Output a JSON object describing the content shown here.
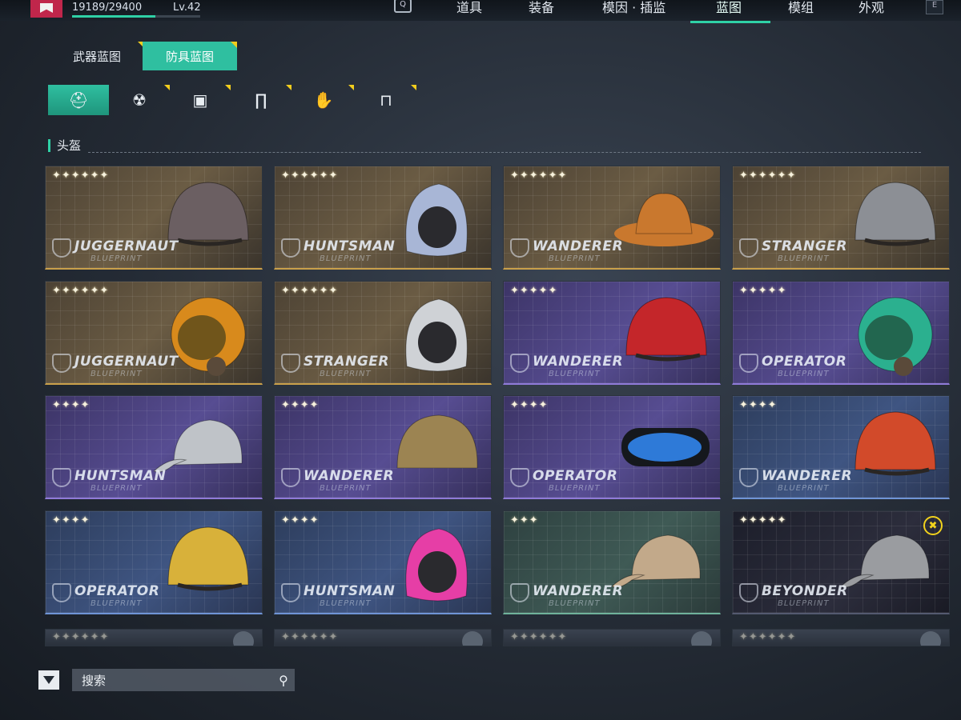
{
  "header": {
    "xp": "19189/29400",
    "xp_progress": 0.653,
    "level": "Lv.42",
    "search_key": "Q",
    "right_key": "E",
    "nav": [
      {
        "label": "道具"
      },
      {
        "label": "装备"
      },
      {
        "label": "模因 · 插监"
      },
      {
        "label": "蓝图"
      },
      {
        "label": "模组"
      },
      {
        "label": "外观"
      }
    ],
    "active_nav": "蓝图"
  },
  "main_tabs": [
    {
      "label": "武器蓝图",
      "active": false
    },
    {
      "label": "防具蓝图",
      "active": true
    }
  ],
  "category_tabs": [
    {
      "icon": "helmet-icon",
      "glyph": "⛑",
      "active": true
    },
    {
      "icon": "gas-mask-icon",
      "glyph": "☢",
      "active": false
    },
    {
      "icon": "armor-vest-icon",
      "glyph": "▣",
      "active": false
    },
    {
      "icon": "pants-icon",
      "glyph": "∏",
      "active": false
    },
    {
      "icon": "gloves-icon",
      "glyph": "✋",
      "active": false
    },
    {
      "icon": "boots-icon",
      "glyph": "⊓",
      "active": false
    }
  ],
  "section_title": "头盔",
  "cards": [
    {
      "brand": "JUGGERNAUT",
      "sub": "BLUEPRINT",
      "stars": "✦✦✦✦✦✦",
      "tier": "gold",
      "helmet_color": "#6b5f62",
      "helmet_type": "dome"
    },
    {
      "brand": "HUNTSMAN",
      "sub": "BLUEPRINT",
      "stars": "✦✦✦✦✦✦",
      "tier": "gold",
      "helmet_color": "#a8b6d6",
      "helmet_type": "hood"
    },
    {
      "brand": "WANDERER",
      "sub": "BLUEPRINT",
      "stars": "✦✦✦✦✦✦",
      "tier": "gold",
      "helmet_color": "#c9782e",
      "helmet_type": "hat"
    },
    {
      "brand": "STRANGER",
      "sub": "BLUEPRINT",
      "stars": "✦✦✦✦✦✦",
      "tier": "gold",
      "helmet_color": "#8c8f95",
      "helmet_type": "dome"
    },
    {
      "brand": "JUGGERNAUT",
      "sub": "BLUEPRINT",
      "stars": "✦✦✦✦✦✦",
      "tier": "gold",
      "helmet_color": "#d88a1c",
      "helmet_type": "visor"
    },
    {
      "brand": "STRANGER",
      "sub": "BLUEPRINT",
      "stars": "✦✦✦✦✦✦",
      "tier": "gold",
      "helmet_color": "#cfd2d6",
      "helmet_type": "hood"
    },
    {
      "brand": "WANDERER",
      "sub": "BLUEPRINT",
      "stars": "✦✦✦✦✦",
      "tier": "purple",
      "helmet_color": "#c4262a",
      "helmet_type": "dome"
    },
    {
      "brand": "OPERATOR",
      "sub": "BLUEPRINT",
      "stars": "✦✦✦✦✦",
      "tier": "purple",
      "helmet_color": "#2bb08f",
      "helmet_type": "visor"
    },
    {
      "brand": "HUNTSMAN",
      "sub": "BLUEPRINT",
      "stars": "✦✦✦✦",
      "tier": "purple",
      "helmet_color": "#bfc3c8",
      "helmet_type": "cap"
    },
    {
      "brand": "WANDERER",
      "sub": "BLUEPRINT",
      "stars": "✦✦✦✦",
      "tier": "purple",
      "helmet_color": "#9c8452",
      "helmet_type": "beanie"
    },
    {
      "brand": "OPERATOR",
      "sub": "BLUEPRINT",
      "stars": "✦✦✦✦",
      "tier": "purple",
      "helmet_color": "#2e7ad8",
      "helmet_type": "goggles"
    },
    {
      "brand": "WANDERER",
      "sub": "BLUEPRINT",
      "stars": "✦✦✦✦",
      "tier": "blue",
      "helmet_color": "#d24a2a",
      "helmet_type": "dome"
    },
    {
      "brand": "OPERATOR",
      "sub": "BLUEPRINT",
      "stars": "✦✦✦✦",
      "tier": "blue",
      "helmet_color": "#d8b13a",
      "helmet_type": "dome"
    },
    {
      "brand": "HUNTSMAN",
      "sub": "BLUEPRINT",
      "stars": "✦✦✦✦",
      "tier": "blue",
      "helmet_color": "#e63ea6",
      "helmet_type": "hood"
    },
    {
      "brand": "WANDERER",
      "sub": "BLUEPRINT",
      "stars": "✦✦✦",
      "tier": "green",
      "helmet_color": "#c2a98a",
      "helmet_type": "cap"
    },
    {
      "brand": "BEYONDER",
      "sub": "BLUEPRINT",
      "stars": "✦✦✦✦✦",
      "tier": "dark",
      "helmet_color": "#9a9ca0",
      "helmet_type": "cap",
      "badge": "✖"
    }
  ],
  "partial_stars": [
    "✦✦✦✦✦✦",
    "✦✦✦✦✦✦",
    "✦✦✦✦✦✦",
    "✦✦✦✦✦✦"
  ],
  "search": {
    "placeholder": "搜索",
    "icon": "search-icon"
  },
  "colors": {
    "accent": "#2fd1a6",
    "corner_mark": "#f2cd1d",
    "new_badge": "#f2d21c"
  }
}
